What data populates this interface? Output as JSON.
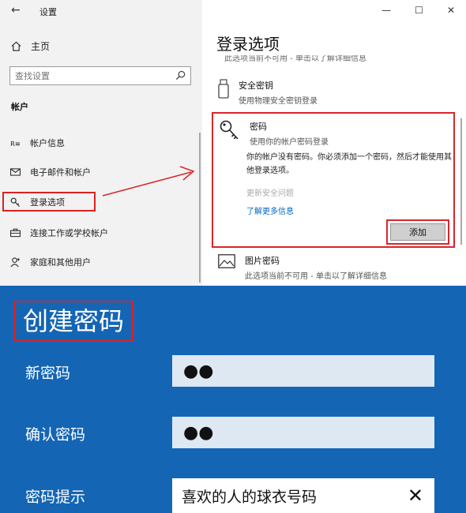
{
  "window": {
    "title": "设置",
    "back_icon": "back-arrow-icon",
    "controls": [
      "minimize-icon",
      "maximize-icon",
      "close-icon"
    ]
  },
  "sidebar": {
    "home_label": "主页",
    "search_placeholder": "查找设置",
    "section_title": "帐户",
    "items": [
      {
        "label": "帐户信息",
        "icon": "person-card-icon"
      },
      {
        "label": "电子邮件和帐户",
        "icon": "mail-icon"
      },
      {
        "label": "登录选项",
        "icon": "key-icon",
        "selected": true
      },
      {
        "label": "连接工作或学校帐户",
        "icon": "briefcase-icon"
      },
      {
        "label": "家庭和其他用户",
        "icon": "person-add-icon"
      }
    ]
  },
  "main": {
    "page_title": "登录选项",
    "cut_text": "此选项当前不可用 - 单击以了解详细信息",
    "options": [
      {
        "title": "安全密钥",
        "desc": "使用物理安全密钥登录",
        "icon": "usb-key-icon"
      },
      {
        "title": "密码",
        "desc": "使用你的帐户密码登录",
        "icon": "key-icon"
      },
      {
        "title": "图片密码",
        "desc": "此选项当前不可用 - 单击以了解详细信息",
        "icon": "picture-icon"
      }
    ],
    "password_body": "你的帐户没有密码。你必须添加一个密码，然后才能使用其他登录选项。",
    "update_security": "更新安全问题",
    "learn_more": "了解更多信息",
    "add_button": "添加"
  },
  "create_password": {
    "title": "创建密码",
    "new_password_label": "新密码",
    "new_password_value": "●●",
    "confirm_label": "确认密码",
    "confirm_value": "●●",
    "hint_label": "密码提示",
    "hint_value": "喜欢的人的球衣号码"
  },
  "colors": {
    "accent_blue": "#1565b5",
    "highlight_red": "#d8262a",
    "link_blue": "#0067c0"
  }
}
